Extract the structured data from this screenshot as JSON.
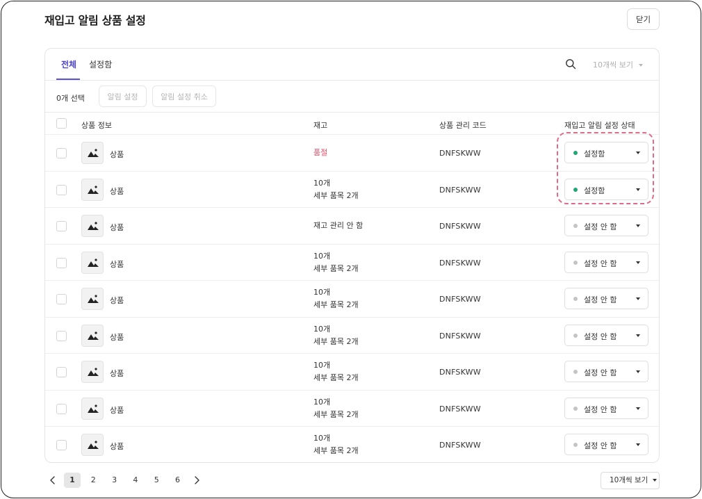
{
  "header": {
    "title": "재입고 알림 상품 설정",
    "close_label": "닫기"
  },
  "tabs": [
    {
      "label": "전체",
      "active": true
    },
    {
      "label": "설정함",
      "active": false
    }
  ],
  "per_page_top": "10개씩 보기",
  "toolbar": {
    "selected_count": "0개 선택",
    "set_alert_label": "알림 설정",
    "cancel_alert_label": "알림 설정 취소"
  },
  "table": {
    "columns": [
      "상품 정보",
      "재고",
      "상품 관리 코드",
      "재입고 알림 설정 상태"
    ],
    "rows": [
      {
        "name": "상품",
        "stock": "품절",
        "stock_sub": "",
        "code": "DNFSKWW",
        "status": "설정함",
        "status_on": true
      },
      {
        "name": "상품",
        "stock": "10개",
        "stock_sub": "세부 품목 2개",
        "code": "DNFSKWW",
        "status": "설정함",
        "status_on": true
      },
      {
        "name": "상품",
        "stock": "재고 관리 안 함",
        "stock_sub": "",
        "code": "DNFSKWW",
        "status": "설정 안 함",
        "status_on": false
      },
      {
        "name": "상품",
        "stock": "10개",
        "stock_sub": "세부 품목 2개",
        "code": "DNFSKWW",
        "status": "설정 안 함",
        "status_on": false
      },
      {
        "name": "상품",
        "stock": "10개",
        "stock_sub": "세부 품목 2개",
        "code": "DNFSKWW",
        "status": "설정 안 함",
        "status_on": false
      },
      {
        "name": "상품",
        "stock": "10개",
        "stock_sub": "세부 품목 2개",
        "code": "DNFSKWW",
        "status": "설정 안 함",
        "status_on": false
      },
      {
        "name": "상품",
        "stock": "10개",
        "stock_sub": "세부 품목 2개",
        "code": "DNFSKWW",
        "status": "설정 안 함",
        "status_on": false
      },
      {
        "name": "상품",
        "stock": "10개",
        "stock_sub": "세부 품목 2개",
        "code": "DNFSKWW",
        "status": "설정 안 함",
        "status_on": false
      },
      {
        "name": "상품",
        "stock": "10개",
        "stock_sub": "세부 품목 2개",
        "code": "DNFSKWW",
        "status": "설정 안 함",
        "status_on": false
      }
    ]
  },
  "pagination": {
    "pages": [
      "1",
      "2",
      "3",
      "4",
      "5",
      "6"
    ],
    "current": "1",
    "per_page": "10개씩 보기"
  },
  "colors": {
    "accent": "#4c44d1",
    "status_on": "#1fa774",
    "status_off": "#c4c4c4",
    "sold_out": "#e0506a",
    "highlight": "#e06a86"
  },
  "icons": {
    "search": "search-icon",
    "thumbnail": "image-icon",
    "prev": "chevron-left-icon",
    "next": "chevron-right-icon"
  }
}
